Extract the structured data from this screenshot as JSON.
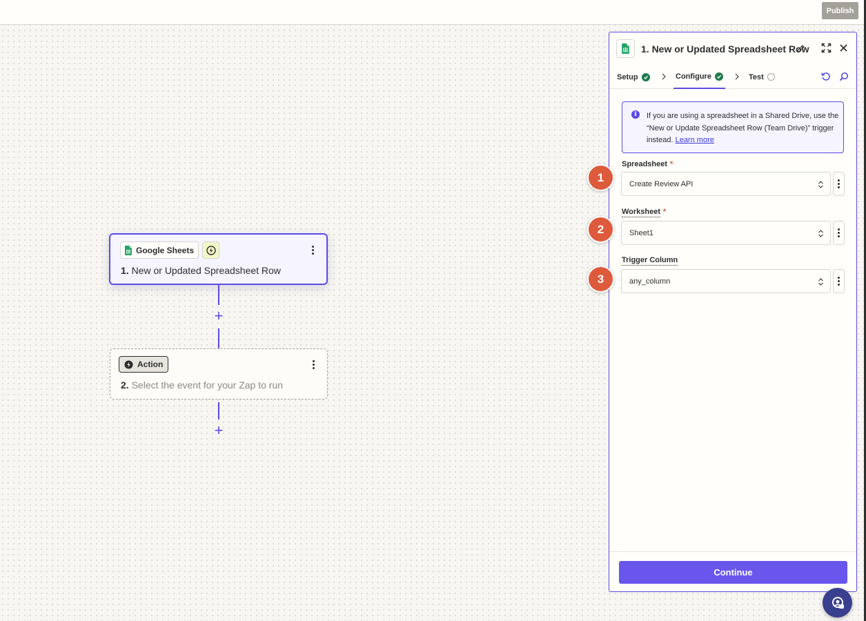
{
  "topbar": {
    "publish_label": "Publish"
  },
  "canvas": {
    "trigger_node": {
      "app_name": "Google Sheets",
      "step_number": "1.",
      "title": "New or Updated Spreadsheet Row",
      "app_icon": "google-sheets-icon",
      "bolt_icon": "bolt-icon"
    },
    "action_node": {
      "chip_label": "Action",
      "step_number": "2.",
      "title": "Select the event for your Zap to run"
    },
    "add_step_label": "+"
  },
  "panel": {
    "title": "1. New or Updated Spreadsheet Row",
    "tabs": [
      {
        "label": "Setup",
        "status": "complete"
      },
      {
        "label": "Configure",
        "status": "complete"
      },
      {
        "label": "Test",
        "status": "pending"
      }
    ],
    "info": {
      "text": "If you are using a spreadsheet in a Shared Drive, use the “New or Update Spreadsheet Row (Team Drive)” trigger instead.",
      "link_label": "Learn more"
    },
    "fields": [
      {
        "label": "Spreadsheet",
        "required": "*",
        "value": "Create Review API",
        "marker": "1"
      },
      {
        "label": "Worksheet",
        "required": "*",
        "value": "Sheet1",
        "marker": "2"
      },
      {
        "label": "Trigger Column",
        "required": "",
        "value": "any_column",
        "marker": "3"
      }
    ],
    "continue_label": "Continue"
  },
  "colors": {
    "accent": "#5b4be0",
    "continue": "#6956ec",
    "marker": "#dd5a3c",
    "success": "#1f7a4d",
    "sheets_green": "#1ea362"
  }
}
